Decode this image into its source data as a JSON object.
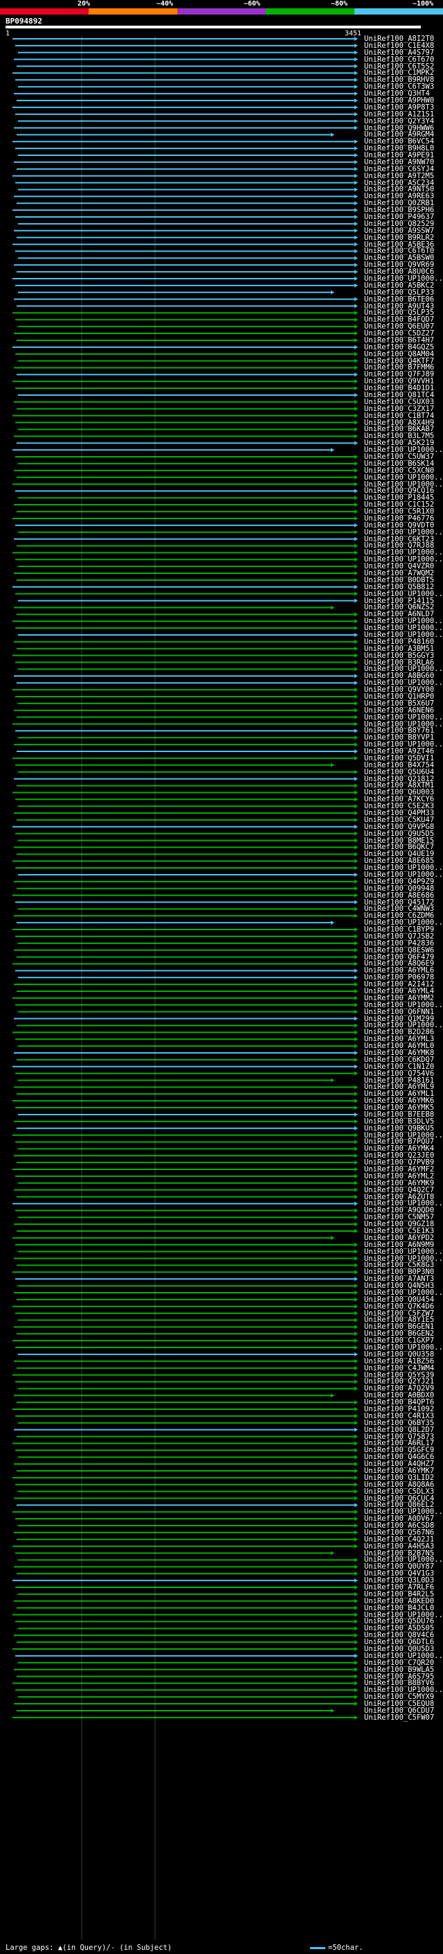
{
  "legend": {
    "ticks": [
      "20%",
      "~40%",
      "~60%",
      "~80%",
      "~100%"
    ],
    "colors": [
      "#e8001c",
      "#ff7f00",
      "#9932cc",
      "#00b300",
      "#4ec3ef"
    ]
  },
  "query": {
    "id": "BP094892",
    "scale_start": "1",
    "scale_end": "3451"
  },
  "hits": [
    "UniRef100_A8I2T0",
    "UniRef100_C1E4X8",
    "UniRef100_A4S797",
    "UniRef100_C6T670",
    "UniRef100_C6T5S2",
    "UniRef100_C1MPK2",
    "UniRef100_B9RHV8",
    "UniRef100_C6T3W3",
    "UniRef100_Q3HT4",
    "UniRef100_A9PHW0",
    "UniRef100_A9P8T3",
    "UniRef100_A1Z1S1",
    "UniRef100_Q2Y3Y4",
    "UniRef100_Q9HWW6",
    "UniRef100_A9RGM4",
    "UniRef100_B6VC54",
    "UniRef100_B9H8L0",
    "UniRef100_A9PE91",
    "UniRef100_A9NW70",
    "UniRef100_C6SYJ4",
    "UniRef100_A9T2M5",
    "UniRef100_A5C234",
    "UniRef100_A9NT50",
    "UniRef100_A9RE63",
    "UniRef100_Q0ZRB1",
    "UniRef100_B9SPH6",
    "UniRef100_P49637",
    "UniRef100_Q82529",
    "UniRef100_A9SSW7",
    "UniRef100_B9RLR2",
    "UniRef100_A5BE36",
    "UniRef100_C6T6T0",
    "UniRef100_A5BSW0",
    "UniRef100_Q9VR69",
    "UniRef100_A8U0C6",
    "UniRef100_UP1000...",
    "UniRef100_A5BKC2",
    "UniRef100_Q5LP33",
    "UniRef100_B6TE06",
    "UniRef100_A9UT43",
    "UniRef100_Q5LP35",
    "UniRef100_B4FQD7",
    "UniRef100_Q6EU07",
    "UniRef100_C5DZ27",
    "UniRef100_B6T4H7",
    "UniRef100_B4GQZ5",
    "UniRef100_Q8AM04",
    "UniRef100_Q4KTF7",
    "UniRef100_B7FMM6",
    "UniRef100_Q7FJ89",
    "UniRef100_Q9VVH1",
    "UniRef100_B4D1D1",
    "UniRef100_Q81TC4",
    "UniRef100_C5UX03",
    "UniRef100_C3ZX17",
    "UniRef100_C1BT74",
    "UniRef100_A8X4H9",
    "UniRef100_B6KAB7",
    "UniRef100_B3L7M5",
    "UniRef100_A5K219",
    "UniRef100_UP1000...",
    "UniRef100_C5UW37",
    "UniRef100_B6SK14",
    "UniRef100_C5XCN0",
    "UniRef100_UP1000...",
    "UniRef100_UP1000...",
    "UniRef100_Q9CQ16",
    "UniRef100_P18445",
    "UniRef100_C1C152",
    "UniRef100_C5R1X0",
    "UniRef100_P46776",
    "UniRef100_Q9VDT0",
    "UniRef100_UP1000...",
    "UniRef100_C6KT23",
    "UniRef100_Q7RJ88",
    "UniRef100_UP1000...",
    "UniRef100_UP1000...",
    "UniRef100_Q4VZR0",
    "UniRef100_A7WQM2",
    "UniRef100_B0DBT5",
    "UniRef100_Q5B812",
    "UniRef100_UP1000...",
    "UniRef100_P14115",
    "UniRef100_Q6NZS2",
    "UniRef100_A6NLD7",
    "UniRef100_UP1000...",
    "UniRef100_UP1000...",
    "UniRef100_UP1000...",
    "UniRef100_P48160",
    "UniRef100_A3BM51",
    "UniRef100_B5GGY3",
    "UniRef100_B3RLA6",
    "UniRef100_UP1000...",
    "UniRef100_A8BG60",
    "UniRef100_UP1000...",
    "UniRef100_Q9VY00",
    "UniRef100_Q1HRP0",
    "UniRef100_B5X6U7",
    "UniRef100_A6NEN6",
    "UniRef100_UP1000...",
    "UniRef100_UP1000...",
    "UniRef100_B8Y761",
    "UniRef100_B8YVP1",
    "UniRef100_UP1000...",
    "UniRef100_A9ZT46",
    "UniRef100_Q5DVI1",
    "UniRef100_B4X754",
    "UniRef100_Q5U6U4",
    "UniRef100_Q21812",
    "UniRef100_A8XTM1",
    "UniRef100_Q6U003",
    "UniRef100_A7KCY6",
    "UniRef100_C5E2K3",
    "UniRef100_Q4PM33",
    "UniRef100_C5KU47",
    "UniRef100_Q9VPG8",
    "UniRef100_Q9U5D5",
    "UniRef100_B8ME15",
    "UniRef100_B6QKC7",
    "UniRef100_Q4UE19",
    "UniRef100_A8E685",
    "UniRef100_UP1000...",
    "UniRef100_UP1000...",
    "UniRef100_Q4P9Z9",
    "UniRef100_Q09948",
    "UniRef100_A8E686",
    "UniRef100_Q45172",
    "UniRef100_C4WNW3",
    "UniRef100_C6ZDM6",
    "UniRef100_UP1000...",
    "UniRef100_C1BYP9",
    "UniRef100_Q7JSB2",
    "UniRef100_P42836",
    "UniRef100_Q8ESW6",
    "UniRef100_Q6F479",
    "UniRef100_A8Q6E9",
    "UniRef100_A6YML6",
    "UniRef100_P06978",
    "UniRef100_A2I412",
    "UniRef100_A6YML4",
    "UniRef100_A6YMM2",
    "UniRef100_UP1000...",
    "UniRef100_Q6FNN1",
    "UniRef100_Q1M299",
    "UniRef100_UP1000...",
    "UniRef100_B2D286",
    "UniRef100_A6YML3",
    "UniRef100_A6YML0",
    "UniRef100_A6YMK8",
    "UniRef100_C6KDQ7",
    "UniRef100_C1N1Z0",
    "UniRef100_Q754V6",
    "UniRef100_P48161",
    "UniRef100_A6YML9",
    "UniRef100_A6YML1",
    "UniRef100_A6YMK6",
    "UniRef100_A6YMK5",
    "UniRef100_B7EEB8",
    "UniRef100_B3DLV5",
    "UniRef100_Q9BKU5",
    "UniRef100_UP1000...",
    "UniRef100_B7PQU7",
    "UniRef100_A6YMK4",
    "UniRef100_Q23JE0",
    "UniRef100_Q7PVB9",
    "UniRef100_A6YMF2",
    "UniRef100_A6YML2",
    "UniRef100_A6YMK9",
    "UniRef100_Q4Q2C7",
    "UniRef100_A6ZUT8",
    "UniRef100_UP1000...",
    "UniRef100_A9QQD0",
    "UniRef100_C5NM57",
    "UniRef100_Q9GZ18",
    "UniRef100_C5E1K3",
    "UniRef100_A6YPD2",
    "UniRef100_A6N9M9",
    "UniRef100_UP1000...",
    "UniRef100_UP1000...",
    "UniRef100_C5K8G3",
    "UniRef100_B0P3N0",
    "UniRef100_A7ANT3",
    "UniRef100_Q4N5H3",
    "UniRef100_UP1000...",
    "UniRef100_Q0U454",
    "UniRef100_Q7K4D6",
    "UniRef100_C5FZW7",
    "UniRef100_A8Y1E5",
    "UniRef100_B6GEN1",
    "UniRef100_B6GEN2",
    "UniRef100_C1GXP7",
    "UniRef100_UP1000...",
    "UniRef100_Q0U358",
    "UniRef100_A1BZ56",
    "UniRef100_C4JWM4",
    "UniRef100_Q5YS39",
    "UniRef100_Q2YJ21",
    "UniRef100_A7Q2V9",
    "UniRef100_A0BDX0",
    "UniRef100_B4QPT6",
    "UniRef100_P41092",
    "UniRef100_C4R1X3",
    "UniRef100_Q6BY35",
    "UniRef100_Q8L2D7",
    "UniRef100_Q75873",
    "UniRef100_A6RL17",
    "UniRef100_Q5GFC9",
    "UniRef100_Q4G6C6",
    "UniRef100_A4QHZ7",
    "UniRef100_A6YMK7",
    "UniRef100_Q3LID2",
    "UniRef100_A8Q8A6",
    "UniRef100_C5DLX3",
    "UniRef100_Q6CUC4",
    "UniRef100_Q86EL2",
    "UniRef100_UP1000...",
    "UniRef100_A0DV67",
    "UniRef100_A6CSD8",
    "UniRef100_Q567N6",
    "UniRef100_C4Q2J1",
    "UniRef100_A4H5A3",
    "UniRef100_B2B7N5",
    "UniRef100_UP1000...",
    "UniRef100_Q0UY87",
    "UniRef100_Q4V1G3",
    "UniRef100_Q3L0D3",
    "UniRef100_A7RLF6",
    "UniRef100_B4R2L5",
    "UniRef100_A8KED0",
    "UniRef100_B4JCL0",
    "UniRef100_UP1000...",
    "UniRef100_Q5DU76",
    "UniRef100_A5DS05",
    "UniRef100_Q8V4C6",
    "UniRef100_Q6DTL6",
    "UniRef100_Q0U5D3",
    "UniRef100_UP1000...",
    "UniRef100_C7QR20",
    "UniRef100_B9WLA5",
    "UniRef100_A6S795",
    "UniRef100_B8BYV6",
    "UniRef100_UP1000...",
    "UniRef100_C5MYX9",
    "UniRef100_C5EQU8",
    "UniRef100_Q6CDU7",
    "UniRef100_C5FW07"
  ],
  "footer": {
    "gaps_label": "Large gaps: ▲(in Query)/- (in Subject)",
    "scale_label": "=50char."
  }
}
